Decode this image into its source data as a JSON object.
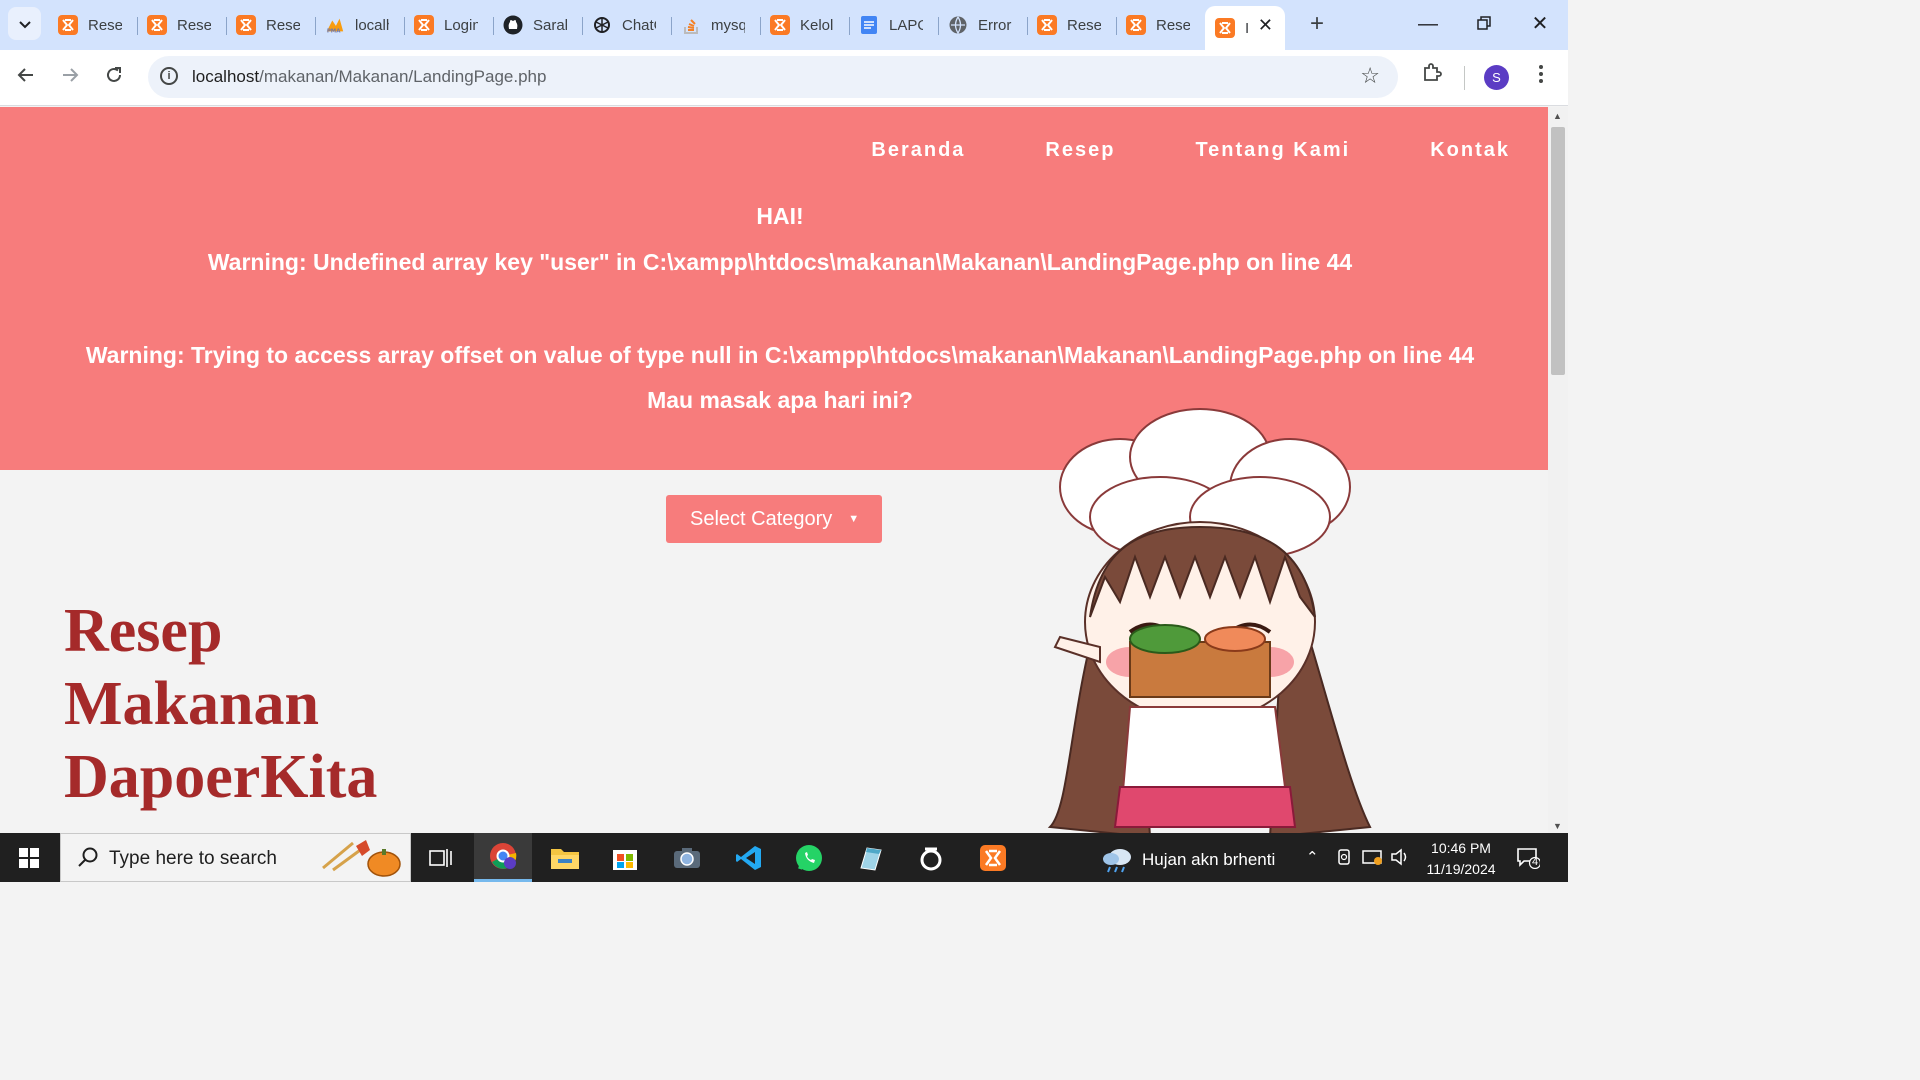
{
  "browser": {
    "tabs": [
      {
        "title": "Resep",
        "icon": "xampp-icon"
      },
      {
        "title": "Resep",
        "icon": "xampp-icon"
      },
      {
        "title": "Resep",
        "icon": "xampp-icon"
      },
      {
        "title": "localhost",
        "icon": "phpmyadmin-icon"
      },
      {
        "title": "Login",
        "icon": "xampp-icon"
      },
      {
        "title": "Sarah",
        "icon": "github-icon"
      },
      {
        "title": "ChatGPT",
        "icon": "chatgpt-icon"
      },
      {
        "title": "mysql",
        "icon": "stackoverflow-icon"
      },
      {
        "title": "Kelola",
        "icon": "xampp-icon"
      },
      {
        "title": "LAPORAN",
        "icon": "docs-icon"
      },
      {
        "title": "Error",
        "icon": "globe-icon"
      },
      {
        "title": "Resep",
        "icon": "xampp-icon"
      },
      {
        "title": "Resep",
        "icon": "xampp-icon"
      },
      {
        "title": "I",
        "icon": "xampp-icon",
        "active": true
      }
    ],
    "url_host": "localhost",
    "url_path": "/makanan/Makanan/LandingPage.php",
    "profile_initial": "S"
  },
  "page": {
    "nav": [
      "Beranda",
      "Resep",
      "Tentang Kami",
      "Kontak"
    ],
    "greeting": "HAI!",
    "warning1": "Warning: Undefined array key \"user\" in C:\\xampp\\htdocs\\makanan\\Makanan\\LandingPage.php on line 44",
    "warning2": "Warning: Trying to access array offset on value of type null in C:\\xampp\\htdocs\\makanan\\Makanan\\LandingPage.php on line 44",
    "question": "Mau masak apa hari ini?",
    "select_label": "Select Category",
    "title_lines": [
      "Resep",
      "Makanan",
      "DapoerKita"
    ],
    "colors": {
      "hero_bg": "#f77c7c",
      "title": "#a52a2a",
      "page_bg": "#f3f3f3"
    }
  },
  "taskbar": {
    "search_placeholder": "Type here to search",
    "weather": "Hujan akn brhenti",
    "time": "10:46 PM",
    "date": "11/19/2024",
    "notifications": "4"
  }
}
